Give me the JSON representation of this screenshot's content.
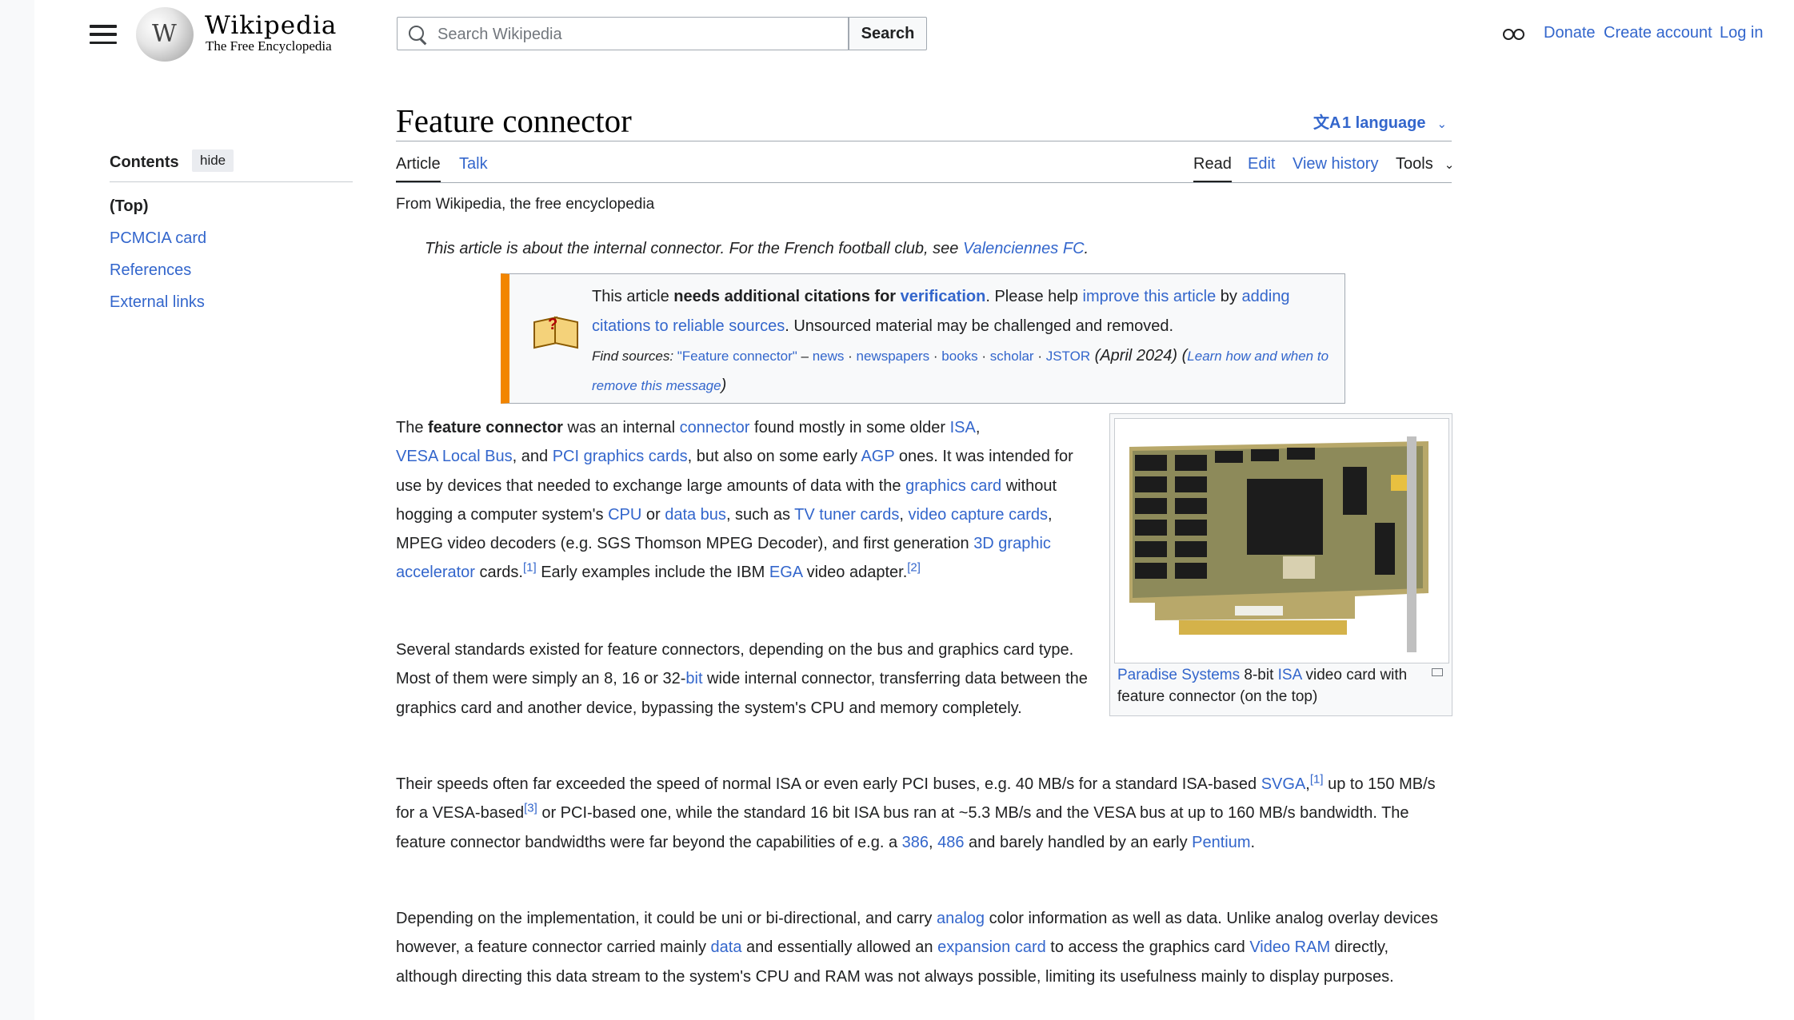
{
  "header": {
    "wordmark": "Wikipedia",
    "tagline": "The Free Encyclopedia",
    "search_placeholder": "Search Wikipedia",
    "search_button": "Search",
    "links": [
      "Donate",
      "Create account",
      "Log in"
    ]
  },
  "toc": {
    "title": "Contents",
    "hide": "hide",
    "items": [
      "(Top)",
      "PCMCIA card",
      "References",
      "External links"
    ]
  },
  "article": {
    "title": "Feature connector",
    "language_button": "1 language",
    "tabs": {
      "article": "Article",
      "talk": "Talk",
      "read": "Read",
      "edit": "Edit",
      "history": "View history",
      "tools": "Tools"
    },
    "from": "From Wikipedia, the free encyclopedia",
    "hatnote": {
      "text": "This article is about the internal connector. For the French football club, see ",
      "link": "Valenciennes FC",
      "end": "."
    },
    "ambox": {
      "t1": "This article ",
      "t2": "needs additional citations for ",
      "t3": "verification",
      "t4": ". Please help ",
      "t5": "improve this article",
      "t6": " by ",
      "t7": "adding citations to reliable sources",
      "t8": ". Unsourced material may be challenged and removed.",
      "find": "Find sources: ",
      "q": "\"Feature connector\"",
      "dash": " – ",
      "news": "news",
      "dot": " · ",
      "newspapers": "newspapers",
      "books": "books",
      "scholar": "scholar",
      "jstor": "JSTOR",
      "date": " (April 2024)",
      "paren_open": " (",
      "learn": "Learn how and when to remove this message",
      "paren_close": ")"
    },
    "p1": {
      "a": "The ",
      "b": "feature connector",
      "c": " was an internal ",
      "d": "connector",
      "e": " found mostly in some older ",
      "f": "ISA",
      "g": ",",
      "h": "VESA Local Bus",
      "i": ", and ",
      "j": "PCI graphics cards",
      "k": ", but also on some early ",
      "l": "AGP",
      "m": " ones. It was intended for use by devices that needed to exchange large amounts of data with the ",
      "n": "graphics card",
      "o": " without hogging a computer system's ",
      "p": "CPU",
      "q": " or ",
      "r": "data bus",
      "s": ", such as ",
      "t": "TV tuner cards",
      "u": ", ",
      "v": "video capture cards",
      "w": ", MPEG video decoders (e.g. SGS Thomson MPEG Decoder), and first generation ",
      "x": "3D graphic accelerator",
      "y": " cards.",
      "ref1": "[1]",
      "z": " Early examples include the IBM ",
      "ega": "EGA",
      "end": " video adapter.",
      "ref2": "[2]"
    },
    "p2": {
      "a": "Several standards existed for feature connectors, depending on the bus and graphics card type. Most of them were simply an 8, 16 or 32-",
      "bit": "bit",
      "b": " wide internal connector, transferring data between the graphics card and another device, bypassing the system's CPU and memory completely."
    },
    "p3": {
      "a": "Their speeds often far exceeded the speed of normal ISA or even early PCI buses, e.g. 40 MB/s for a standard ISA-based ",
      "svga": "SVGA",
      "c": ",",
      "ref1": "[1]",
      "d": " up to 150 MB/s for a VESA-based",
      "ref3": "[3]",
      "e": " or PCI-based one, while the standard 16 bit ISA bus ran at ~5.3 MB/s and the VESA bus at up to 160 MB/s bandwidth. The feature connector bandwidths were far beyond the capabilities of e.g. a ",
      "i386": "386",
      "comma": ", ",
      "i486": "486",
      "f": " and barely handled by an early ",
      "pentium": "Pentium",
      "g": "."
    },
    "p4": {
      "a": "Depending on the implementation, it could be uni or bi-directional, and carry ",
      "analog": "analog",
      "b": " color information as well as data. Unlike analog overlay devices however, a feature connector carried mainly ",
      "data": "data",
      "c": " and essentially allowed an ",
      "exp": "expansion card",
      "d": " to access the graphics card ",
      "vram": "Video RAM",
      "e": " directly, although directing this data stream to the system's CPU and RAM was not always possible, limiting its usefulness mainly to display purposes."
    },
    "image": {
      "cap_link1": "Paradise Systems",
      "cap_t1": " 8-bit ",
      "cap_link2": "ISA",
      "cap_t2": " video card with feature connector (on the top)"
    }
  }
}
